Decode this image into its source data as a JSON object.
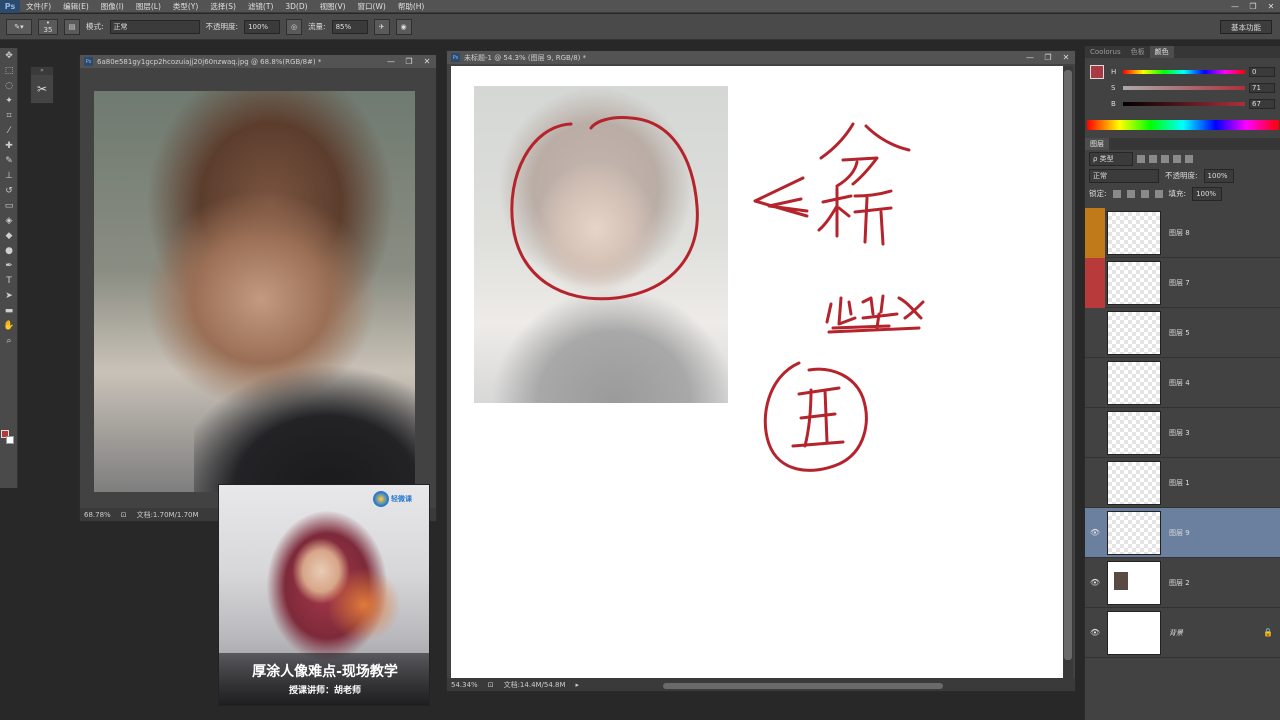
{
  "menubar": {
    "logo": "Ps",
    "items": [
      "文件(F)",
      "编辑(E)",
      "图像(I)",
      "图层(L)",
      "类型(Y)",
      "选择(S)",
      "滤镜(T)",
      "3D(D)",
      "视图(V)",
      "窗口(W)",
      "帮助(H)"
    ],
    "window_controls": [
      "—",
      "❐",
      "✕"
    ]
  },
  "options": {
    "brush_size": "35",
    "mode_label": "模式:",
    "mode_value": "正常",
    "opacity_label": "不透明度:",
    "opacity_value": "100%",
    "flow_label": "流量:",
    "flow_value": "85%",
    "workspace": "基本功能"
  },
  "doc1": {
    "title": "6a80e581gy1gcp2hcozuiajj20j60nzwaq.jpg @ 68.8%(RGB/8#) *",
    "zoom": "68.78%",
    "docsize": "文档:1.70M/1.70M"
  },
  "doc2": {
    "title": "未标题-1 @ 54.3% (图层 9, RGB/8) *",
    "zoom": "54.34%",
    "docsize": "文档:14.4M/54.8M"
  },
  "promo": {
    "title": "厚涂人像难点-现场教学",
    "subtitle": "授课讲师：胡老师",
    "logo_text": "轻微课"
  },
  "color_panel": {
    "tabs": [
      "Coolorus",
      "色板",
      "颜色"
    ],
    "active_tab": 2,
    "h_label": "H",
    "h_value": "0",
    "s_label": "S",
    "s_value": "71",
    "b_label": "B",
    "b_value": "67",
    "swatch_color": "#a83a44"
  },
  "layers_panel": {
    "tab": "图层",
    "filter": "ρ 类型",
    "blend_mode": "正常",
    "opacity_label": "不透明度:",
    "opacity_value": "100%",
    "lock_label": "锁定:",
    "fill_label": "填充:",
    "fill_value": "100%",
    "layers": [
      {
        "name": "图层 8",
        "visible": false,
        "tag_color": "#c07a1a"
      },
      {
        "name": "图层 7",
        "visible": false,
        "tag_color": "#b83a3a"
      },
      {
        "name": "图层 5",
        "visible": false
      },
      {
        "name": "图层 4",
        "visible": false
      },
      {
        "name": "图层 3",
        "visible": false
      },
      {
        "name": "图层 1",
        "visible": false
      },
      {
        "name": "图层 9",
        "visible": true,
        "selected": true
      },
      {
        "name": "图层 2",
        "visible": true
      },
      {
        "name": "背景",
        "visible": true,
        "locked": true
      }
    ],
    "eye_glyph": "👁"
  },
  "annotations": {
    "ink_color": "#b5242c"
  }
}
